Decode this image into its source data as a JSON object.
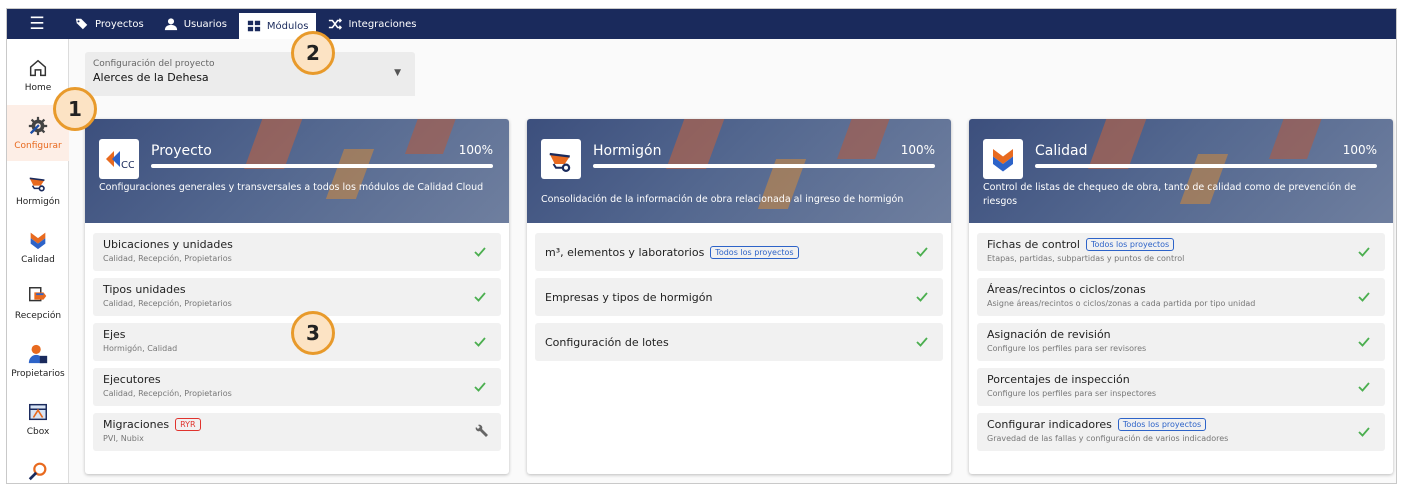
{
  "topbar": {
    "menu_icon": "hamburger-icon",
    "tabs": [
      {
        "label": "Proyectos",
        "icon": "tags-icon",
        "active": false
      },
      {
        "label": "Usuarios",
        "icon": "user-icon",
        "active": false
      },
      {
        "label": "Módulos",
        "icon": "grid-icon",
        "active": true
      },
      {
        "label": "Integraciones",
        "icon": "shuffle-icon",
        "active": false
      }
    ]
  },
  "sidebar": {
    "items": [
      {
        "label": "Home",
        "icon": "home-icon"
      },
      {
        "label": "Configurar",
        "icon": "gear-icon",
        "active": true
      },
      {
        "label": "Hormigón",
        "icon": "wheelbarrow-icon"
      },
      {
        "label": "Calidad",
        "icon": "quality-icon"
      },
      {
        "label": "Recepción",
        "icon": "reception-icon"
      },
      {
        "label": "Propietarios",
        "icon": "owners-icon"
      },
      {
        "label": "Cbox",
        "icon": "cbox-icon"
      },
      {
        "label": "",
        "icon": "search-tool-icon"
      }
    ]
  },
  "project_select": {
    "label": "Configuración del proyecto",
    "value": "Alerces de la Dehesa"
  },
  "cards": [
    {
      "title": "Proyecto",
      "percent": "100%",
      "progress": 1.0,
      "description": "Configuraciones generales y transversales a todos los módulos de Calidad Cloud",
      "rows": [
        {
          "title": "Ubicaciones y unidades",
          "subtitle": "Calidad, Recepción, Propietarios",
          "status": "check"
        },
        {
          "title": "Tipos unidades",
          "subtitle": "Calidad, Recepción, Propietarios",
          "status": "check"
        },
        {
          "title": "Ejes",
          "subtitle": "Hormigón, Calidad",
          "status": "check"
        },
        {
          "title": "Ejecutores",
          "subtitle": "Calidad, Recepción, Propietarios",
          "status": "check"
        },
        {
          "title": "Migraciones",
          "badge": "RYR",
          "subtitle": "PVI, Nubix",
          "status": "wrench"
        }
      ]
    },
    {
      "title": "Hormigón",
      "percent": "100%",
      "progress": 1.0,
      "description": "Consolidación de la información de obra relacionada al ingreso de hormigón",
      "rows": [
        {
          "title": "m³, elementos y laboratorios",
          "badge": "Todos los proyectos",
          "status": "check"
        },
        {
          "title": "Empresas y tipos de hormigón",
          "status": "check"
        },
        {
          "title": "Configuración de lotes",
          "status": "check"
        }
      ]
    },
    {
      "title": "Calidad",
      "percent": "100%",
      "progress": 1.0,
      "description": "Control de listas de chequeo de obra, tanto de calidad como de prevención de riesgos",
      "rows": [
        {
          "title": "Fichas de control",
          "badge": "Todos los proyectos",
          "subtitle": "Etapas, partidas, subpartidas y puntos de control",
          "status": "check"
        },
        {
          "title": "Áreas/recintos o ciclos/zonas",
          "subtitle": "Asigne áreas/recintos o ciclos/zonas a cada partida por tipo unidad",
          "status": "check"
        },
        {
          "title": "Asignación de revisión",
          "subtitle": "Configure los perfiles para ser revisores",
          "status": "check"
        },
        {
          "title": "Porcentajes de inspección",
          "subtitle": "Configure los perfiles para ser inspectores",
          "status": "check"
        },
        {
          "title": "Configurar indicadores",
          "badge": "Todos los proyectos",
          "subtitle": "Gravedad de las fallas y configuración de varios indicadores",
          "status": "check"
        }
      ]
    }
  ],
  "callouts": [
    "1",
    "2",
    "3"
  ],
  "colors": {
    "topbar": "#1a2a5c",
    "accent": "#e86a1f",
    "check": "#4caf50",
    "badge_blue": "#2d63c8",
    "badge_red": "#e0332d"
  }
}
